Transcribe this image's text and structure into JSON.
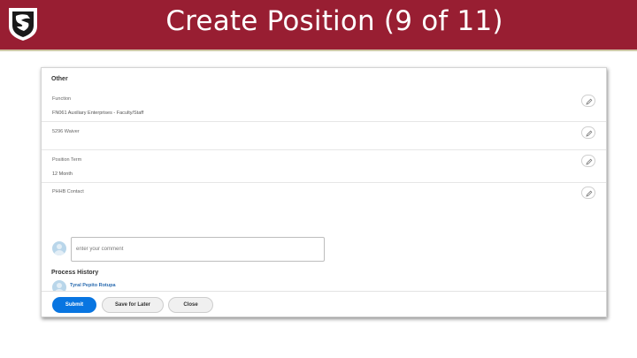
{
  "slide": {
    "title": "Create Position (9 of 11)",
    "colors": {
      "banner": "#981e32",
      "accent_line": "#cfc9a8",
      "primary_button": "#0875e1"
    },
    "logo": "wsu-cougar-logo"
  },
  "form": {
    "section_title": "Other",
    "fields": [
      {
        "label": "Function",
        "value": "FN061 Auxiliary Enterprises - Faculty/Staff",
        "edit_icon": "pencil-icon"
      },
      {
        "label": "5296 Waiver",
        "value": "",
        "edit_icon": "pencil-icon"
      },
      {
        "label": "Position Term",
        "value": "12 Month",
        "edit_icon": "pencil-icon"
      },
      {
        "label": "PHHB Contact",
        "value": "",
        "edit_icon": "pencil-icon"
      }
    ],
    "comment": {
      "placeholder": "enter your comment",
      "avatar_icon": "user-avatar-icon"
    },
    "process_history": {
      "title": "Process History",
      "entry_name": "Tyral Pepito Rotupa"
    },
    "buttons": {
      "submit": "Submit",
      "save_for_later": "Save for Later",
      "close": "Close"
    }
  }
}
